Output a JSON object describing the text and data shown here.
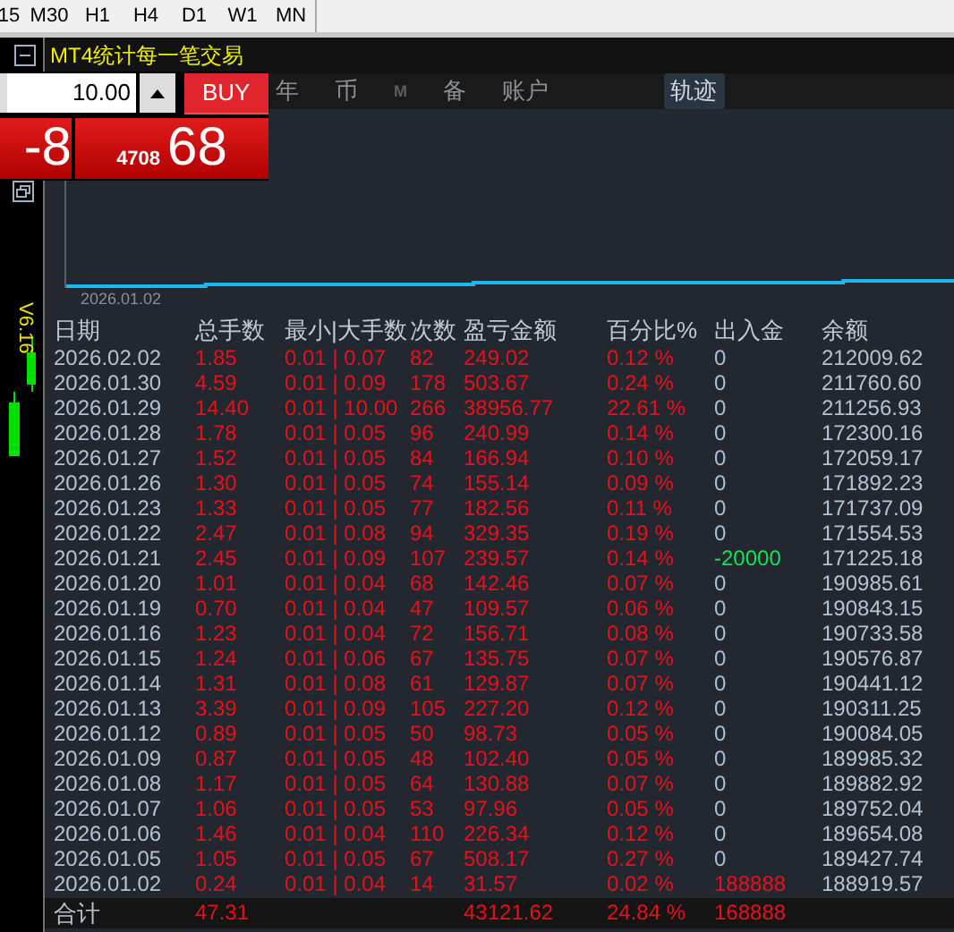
{
  "toolbar": {
    "timeframes": [
      "15",
      "M30",
      "H1",
      "H4",
      "D1",
      "W1",
      "MN"
    ]
  },
  "side": {
    "version": "V6.16"
  },
  "trade_panel": {
    "lot": "10.00",
    "buy_label": "BUY",
    "sell_price": "-8",
    "buy_price_small": "4708",
    "buy_price_big": "68"
  },
  "window": {
    "title": "MT4统计每一笔交易"
  },
  "tabs": [
    {
      "label": "年",
      "selected": false,
      "disabled": false
    },
    {
      "label": "币",
      "selected": false,
      "disabled": false
    },
    {
      "label": "M",
      "selected": false,
      "disabled": true
    },
    {
      "label": "备",
      "selected": false,
      "disabled": false
    },
    {
      "label": "账户",
      "selected": false,
      "disabled": false
    },
    {
      "label": "轨迹",
      "selected": true,
      "disabled": false
    }
  ],
  "chart": {
    "start_date": "2026.01.02"
  },
  "table": {
    "columns": [
      "日期",
      "总手数",
      "最小|大手数",
      "次数",
      "盈亏金额",
      "百分比%",
      "出入金",
      "余额"
    ],
    "rows": [
      {
        "date": "2026.02.02",
        "lots": "1.85",
        "range": "0.01 | 0.07",
        "count": "82",
        "pnl": "249.02",
        "pct": "0.12 %",
        "flow": {
          "text": "0",
          "color": "#a9bfd8"
        },
        "balance": "212009.62"
      },
      {
        "date": "2026.01.30",
        "lots": "4.59",
        "range": "0.01 | 0.09",
        "count": "178",
        "pnl": "503.67",
        "pct": "0.24 %",
        "flow": {
          "text": "0",
          "color": "#a9bfd8"
        },
        "balance": "211760.60"
      },
      {
        "date": "2026.01.29",
        "lots": "14.40",
        "range": "0.01 | 10.00",
        "count": "266",
        "pnl": "38956.77",
        "pct": "22.61 %",
        "flow": {
          "text": "0",
          "color": "#a9bfd8"
        },
        "balance": "211256.93"
      },
      {
        "date": "2026.01.28",
        "lots": "1.78",
        "range": "0.01 | 0.05",
        "count": "96",
        "pnl": "240.99",
        "pct": "0.14 %",
        "flow": {
          "text": "0",
          "color": "#a9bfd8"
        },
        "balance": "172300.16"
      },
      {
        "date": "2026.01.27",
        "lots": "1.52",
        "range": "0.01 | 0.05",
        "count": "84",
        "pnl": "166.94",
        "pct": "0.10 %",
        "flow": {
          "text": "0",
          "color": "#a9bfd8"
        },
        "balance": "172059.17"
      },
      {
        "date": "2026.01.26",
        "lots": "1.30",
        "range": "0.01 | 0.05",
        "count": "74",
        "pnl": "155.14",
        "pct": "0.09 %",
        "flow": {
          "text": "0",
          "color": "#a9bfd8"
        },
        "balance": "171892.23"
      },
      {
        "date": "2026.01.23",
        "lots": "1.33",
        "range": "0.01 | 0.05",
        "count": "77",
        "pnl": "182.56",
        "pct": "0.11 %",
        "flow": {
          "text": "0",
          "color": "#a9bfd8"
        },
        "balance": "171737.09"
      },
      {
        "date": "2026.01.22",
        "lots": "2.47",
        "range": "0.01 | 0.08",
        "count": "94",
        "pnl": "329.35",
        "pct": "0.19 %",
        "flow": {
          "text": "0",
          "color": "#a9bfd8"
        },
        "balance": "171554.53"
      },
      {
        "date": "2026.01.21",
        "lots": "2.45",
        "range": "0.01 | 0.09",
        "count": "107",
        "pnl": "239.57",
        "pct": "0.14 %",
        "flow": {
          "text": "-20000",
          "color": "#19e05a"
        },
        "balance": "171225.18"
      },
      {
        "date": "2026.01.20",
        "lots": "1.01",
        "range": "0.01 | 0.04",
        "count": "68",
        "pnl": "142.46",
        "pct": "0.07 %",
        "flow": {
          "text": "0",
          "color": "#a9bfd8"
        },
        "balance": "190985.61"
      },
      {
        "date": "2026.01.19",
        "lots": "0.70",
        "range": "0.01 | 0.04",
        "count": "47",
        "pnl": "109.57",
        "pct": "0.06 %",
        "flow": {
          "text": "0",
          "color": "#a9bfd8"
        },
        "balance": "190843.15"
      },
      {
        "date": "2026.01.16",
        "lots": "1.23",
        "range": "0.01 | 0.04",
        "count": "72",
        "pnl": "156.71",
        "pct": "0.08 %",
        "flow": {
          "text": "0",
          "color": "#a9bfd8"
        },
        "balance": "190733.58"
      },
      {
        "date": "2026.01.15",
        "lots": "1.24",
        "range": "0.01 | 0.06",
        "count": "67",
        "pnl": "135.75",
        "pct": "0.07 %",
        "flow": {
          "text": "0",
          "color": "#a9bfd8"
        },
        "balance": "190576.87"
      },
      {
        "date": "2026.01.14",
        "lots": "1.31",
        "range": "0.01 | 0.08",
        "count": "61",
        "pnl": "129.87",
        "pct": "0.07 %",
        "flow": {
          "text": "0",
          "color": "#a9bfd8"
        },
        "balance": "190441.12"
      },
      {
        "date": "2026.01.13",
        "lots": "3.39",
        "range": "0.01 | 0.09",
        "count": "105",
        "pnl": "227.20",
        "pct": "0.12 %",
        "flow": {
          "text": "0",
          "color": "#a9bfd8"
        },
        "balance": "190311.25"
      },
      {
        "date": "2026.01.12",
        "lots": "0.89",
        "range": "0.01 | 0.05",
        "count": "50",
        "pnl": "98.73",
        "pct": "0.05 %",
        "flow": {
          "text": "0",
          "color": "#a9bfd8"
        },
        "balance": "190084.05"
      },
      {
        "date": "2026.01.09",
        "lots": "0.87",
        "range": "0.01 | 0.05",
        "count": "48",
        "pnl": "102.40",
        "pct": "0.05 %",
        "flow": {
          "text": "0",
          "color": "#a9bfd8"
        },
        "balance": "189985.32"
      },
      {
        "date": "2026.01.08",
        "lots": "1.17",
        "range": "0.01 | 0.05",
        "count": "64",
        "pnl": "130.88",
        "pct": "0.07 %",
        "flow": {
          "text": "0",
          "color": "#a9bfd8"
        },
        "balance": "189882.92"
      },
      {
        "date": "2026.01.07",
        "lots": "1.06",
        "range": "0.01 | 0.05",
        "count": "53",
        "pnl": "97.96",
        "pct": "0.05 %",
        "flow": {
          "text": "0",
          "color": "#a9bfd8"
        },
        "balance": "189752.04"
      },
      {
        "date": "2026.01.06",
        "lots": "1.46",
        "range": "0.01 | 0.04",
        "count": "110",
        "pnl": "226.34",
        "pct": "0.12 %",
        "flow": {
          "text": "0",
          "color": "#a9bfd8"
        },
        "balance": "189654.08"
      },
      {
        "date": "2026.01.05",
        "lots": "1.05",
        "range": "0.01 | 0.05",
        "count": "67",
        "pnl": "508.17",
        "pct": "0.27 %",
        "flow": {
          "text": "0",
          "color": "#a9bfd8"
        },
        "balance": "189427.74"
      },
      {
        "date": "2026.01.02",
        "lots": "0.24",
        "range": "0.01 | 0.04",
        "count": "14",
        "pnl": "31.57",
        "pct": "0.02 %",
        "flow": {
          "text": "188888",
          "color": "#e8101a"
        },
        "balance": "188919.57"
      }
    ],
    "total": {
      "label": "合计",
      "lots": "47.31",
      "pnl": "43121.62",
      "pct": "24.84 %",
      "flow": {
        "text": "168888",
        "color": "#e8101a"
      }
    }
  }
}
